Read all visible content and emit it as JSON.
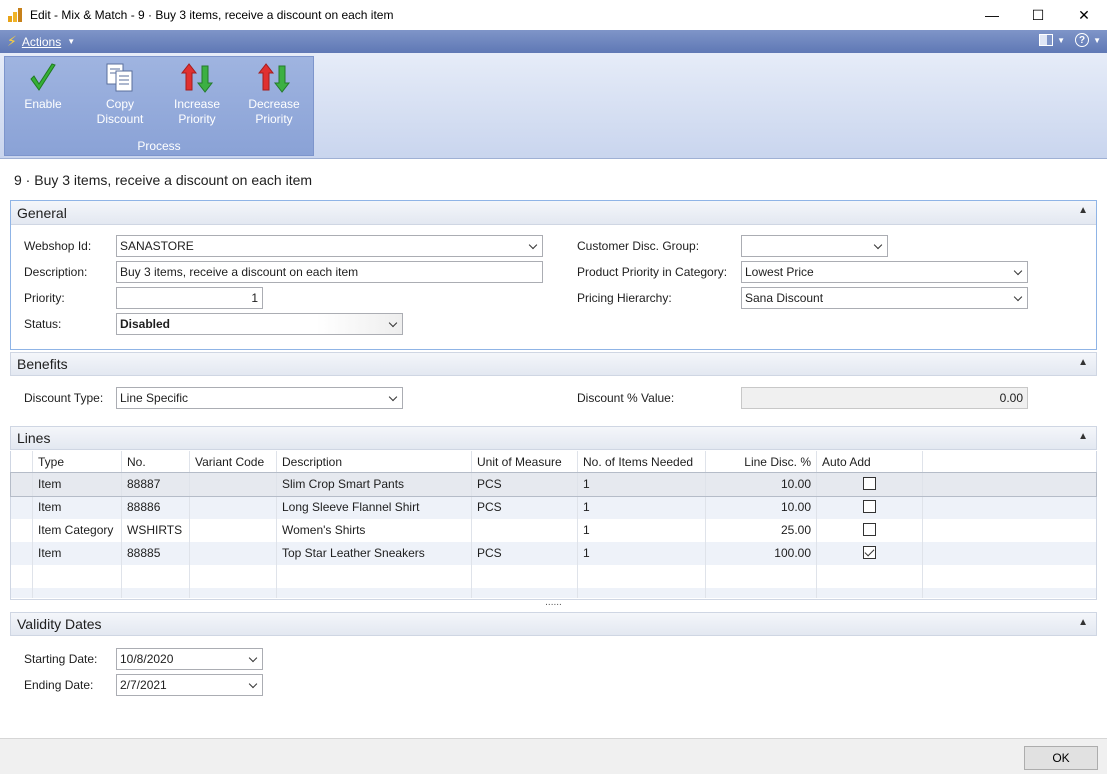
{
  "window": {
    "title": "Edit - Mix & Match - 9 · Buy 3 items, receive a discount on each item",
    "minimize": "—",
    "maximize": "☐",
    "close": "✕"
  },
  "actionbar": {
    "actions_label": "Actions",
    "help": "?"
  },
  "ribbon": {
    "buttons": [
      {
        "line1": "Enable",
        "line2": ""
      },
      {
        "line1": "Copy",
        "line2": "Discount"
      },
      {
        "line1": "Increase",
        "line2": "Priority"
      },
      {
        "line1": "Decrease",
        "line2": "Priority"
      }
    ],
    "group_label": "Process"
  },
  "page_title": "9 · Buy 3 items, receive a discount on each item",
  "general": {
    "header": "General",
    "webshop_id_label": "Webshop Id:",
    "webshop_id_value": "SANASTORE",
    "description_label": "Description:",
    "description_value": "Buy 3 items, receive a discount on each item",
    "priority_label": "Priority:",
    "priority_value": "1",
    "status_label": "Status:",
    "status_value": "Disabled",
    "customer_disc_group_label": "Customer Disc. Group:",
    "customer_disc_group_value": "",
    "product_priority_label": "Product Priority in Category:",
    "product_priority_value": "Lowest Price",
    "pricing_hierarchy_label": "Pricing Hierarchy:",
    "pricing_hierarchy_value": "Sana Discount"
  },
  "benefits": {
    "header": "Benefits",
    "discount_type_label": "Discount Type:",
    "discount_type_value": "Line Specific",
    "discount_value_label": "Discount % Value:",
    "discount_value": "0.00"
  },
  "lines": {
    "header": "Lines",
    "columns": [
      "Type",
      "No.",
      "Variant Code",
      "Description",
      "Unit of Measure",
      "No. of Items Needed",
      "Line Disc. %",
      "Auto Add"
    ],
    "rows": [
      {
        "type": "Item",
        "no": "88887",
        "variant": "",
        "description": "Slim Crop Smart Pants",
        "uom": "PCS",
        "needed": "1",
        "disc": "10.00",
        "auto_add": false
      },
      {
        "type": "Item",
        "no": "88886",
        "variant": "",
        "description": "Long Sleeve Flannel Shirt",
        "uom": "PCS",
        "needed": "1",
        "disc": "10.00",
        "auto_add": false
      },
      {
        "type": "Item Category",
        "no": "WSHIRTS",
        "variant": "",
        "description": "Women's Shirts",
        "uom": "",
        "needed": "1",
        "disc": "25.00",
        "auto_add": false
      },
      {
        "type": "Item",
        "no": "88885",
        "variant": "",
        "description": "Top Star Leather Sneakers",
        "uom": "PCS",
        "needed": "1",
        "disc": "100.00",
        "auto_add": true
      }
    ],
    "splitter": "......"
  },
  "validity": {
    "header": "Validity Dates",
    "starting_label": "Starting Date:",
    "starting_value": "10/8/2020",
    "ending_label": "Ending Date:",
    "ending_value": "2/7/2021"
  },
  "footer": {
    "ok_label": "OK"
  },
  "colors": {
    "ribbon_group": "#8aa2d6",
    "actionbar": "#6f86c0",
    "enable_green": "#2fa82f",
    "arrow_red": "#e03030",
    "arrow_green": "#3cb043"
  }
}
